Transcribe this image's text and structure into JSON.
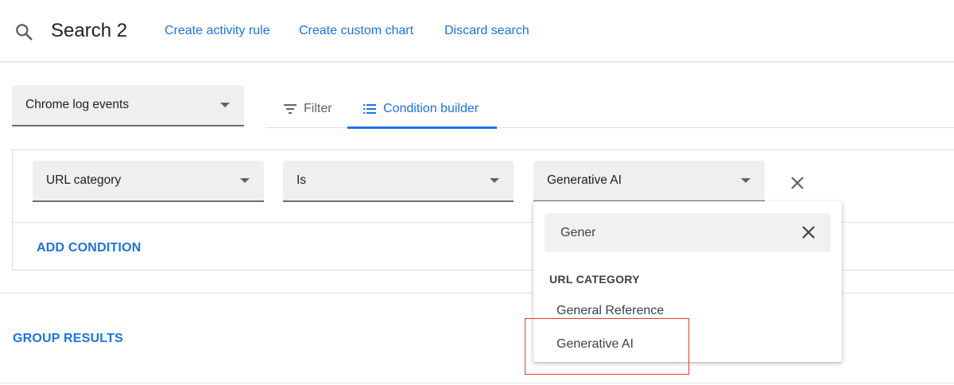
{
  "header": {
    "title": "Search 2",
    "links": [
      "Create activity rule",
      "Create custom chart",
      "Discard search"
    ]
  },
  "data_source": {
    "selected": "Chrome log events"
  },
  "tabs": [
    {
      "label": "Filter",
      "icon": "filter-list-icon",
      "active": false
    },
    {
      "label": "Condition builder",
      "icon": "list-icon",
      "active": true
    }
  ],
  "condition": {
    "field": "URL category",
    "operator": "Is",
    "value": "Generative AI",
    "add_label": "ADD CONDITION"
  },
  "group_results_label": "GROUP RESULTS",
  "dropdown": {
    "search_value": "Gener",
    "section_header": "URL CATEGORY",
    "options": [
      "General Reference",
      "Generative AI"
    ]
  },
  "colors": {
    "accent": "#1a73e8",
    "highlight": "#e53935"
  }
}
